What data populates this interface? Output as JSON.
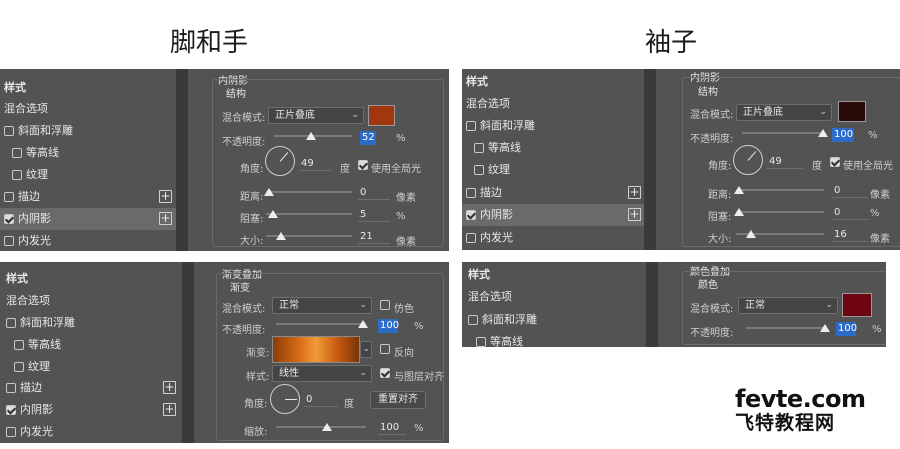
{
  "headings": {
    "left": "脚和手",
    "right": "袖子"
  },
  "panels": {
    "tl": {
      "list": {
        "style": "样式",
        "blend": "混合选项",
        "bevel": "斜面和浮雕",
        "contour": "等高线",
        "texture": "纹理",
        "stroke": "描边",
        "inner_shadow": "内阴影",
        "inner_glow": "内发光"
      },
      "title": "内阴影",
      "subtitle": "结构",
      "blend_mode_label": "混合模式:",
      "blend_mode": "正片叠底",
      "color": "#a2360e",
      "opacity_label": "不透明度:",
      "opacity": "52",
      "opacity_unit": "%",
      "angle_label": "角度:",
      "angle": "49",
      "angle_unit": "度",
      "global_light": "使用全局光",
      "distance_label": "距离:",
      "distance": "0",
      "distance_unit": "像素",
      "choke_label": "阻塞:",
      "choke": "5",
      "choke_unit": "%",
      "size_label": "大小:",
      "size": "21",
      "size_unit": "像素"
    },
    "tr": {
      "list": {
        "style": "样式",
        "blend": "混合选项",
        "bevel": "斜面和浮雕",
        "contour": "等高线",
        "texture": "纹理",
        "stroke": "描边",
        "inner_shadow": "内阴影",
        "inner_glow": "内发光"
      },
      "title": "内阴影",
      "subtitle": "结构",
      "blend_mode_label": "混合模式:",
      "blend_mode": "正片叠底",
      "color": "#2a0a06",
      "opacity_label": "不透明度:",
      "opacity": "100",
      "opacity_unit": "%",
      "angle_label": "角度:",
      "angle": "49",
      "angle_unit": "度",
      "global_light": "使用全局光",
      "distance_label": "距离:",
      "distance": "0",
      "distance_unit": "像素",
      "choke_label": "阻塞:",
      "choke": "0",
      "choke_unit": "%",
      "size_label": "大小:",
      "size": "16",
      "size_unit": "像素"
    },
    "bl": {
      "list": {
        "style": "样式",
        "blend": "混合选项",
        "bevel": "斜面和浮雕",
        "contour": "等高线",
        "texture": "纹理",
        "stroke": "描边",
        "inner_shadow": "内阴影",
        "inner_glow": "内发光"
      },
      "title": "渐变叠加",
      "subtitle": "渐变",
      "blend_mode_label": "混合模式:",
      "blend_mode": "正常",
      "dither": "仿色",
      "opacity_label": "不透明度:",
      "opacity": "100",
      "opacity_unit": "%",
      "gradient_label": "渐变:",
      "reverse": "反向",
      "style_label": "样式:",
      "style_value": "线性",
      "align": "与图层对齐",
      "angle_label": "角度:",
      "angle": "0",
      "angle_unit": "度",
      "reset_button": "重置对齐",
      "scale_label": "缩放:",
      "scale": "100",
      "scale_unit": "%"
    },
    "br": {
      "list": {
        "style": "样式",
        "blend": "混合选项",
        "bevel": "斜面和浮雕",
        "contour": "等高线"
      },
      "title": "颜色叠加",
      "subtitle": "颜色",
      "blend_mode_label": "混合模式:",
      "blend_mode": "正常",
      "color": "#6e0510",
      "opacity_label": "不透明度:",
      "opacity": "100",
      "opacity_unit": "%"
    }
  },
  "watermark": {
    "top": "fevte.com",
    "bottom": "飞特教程网"
  }
}
